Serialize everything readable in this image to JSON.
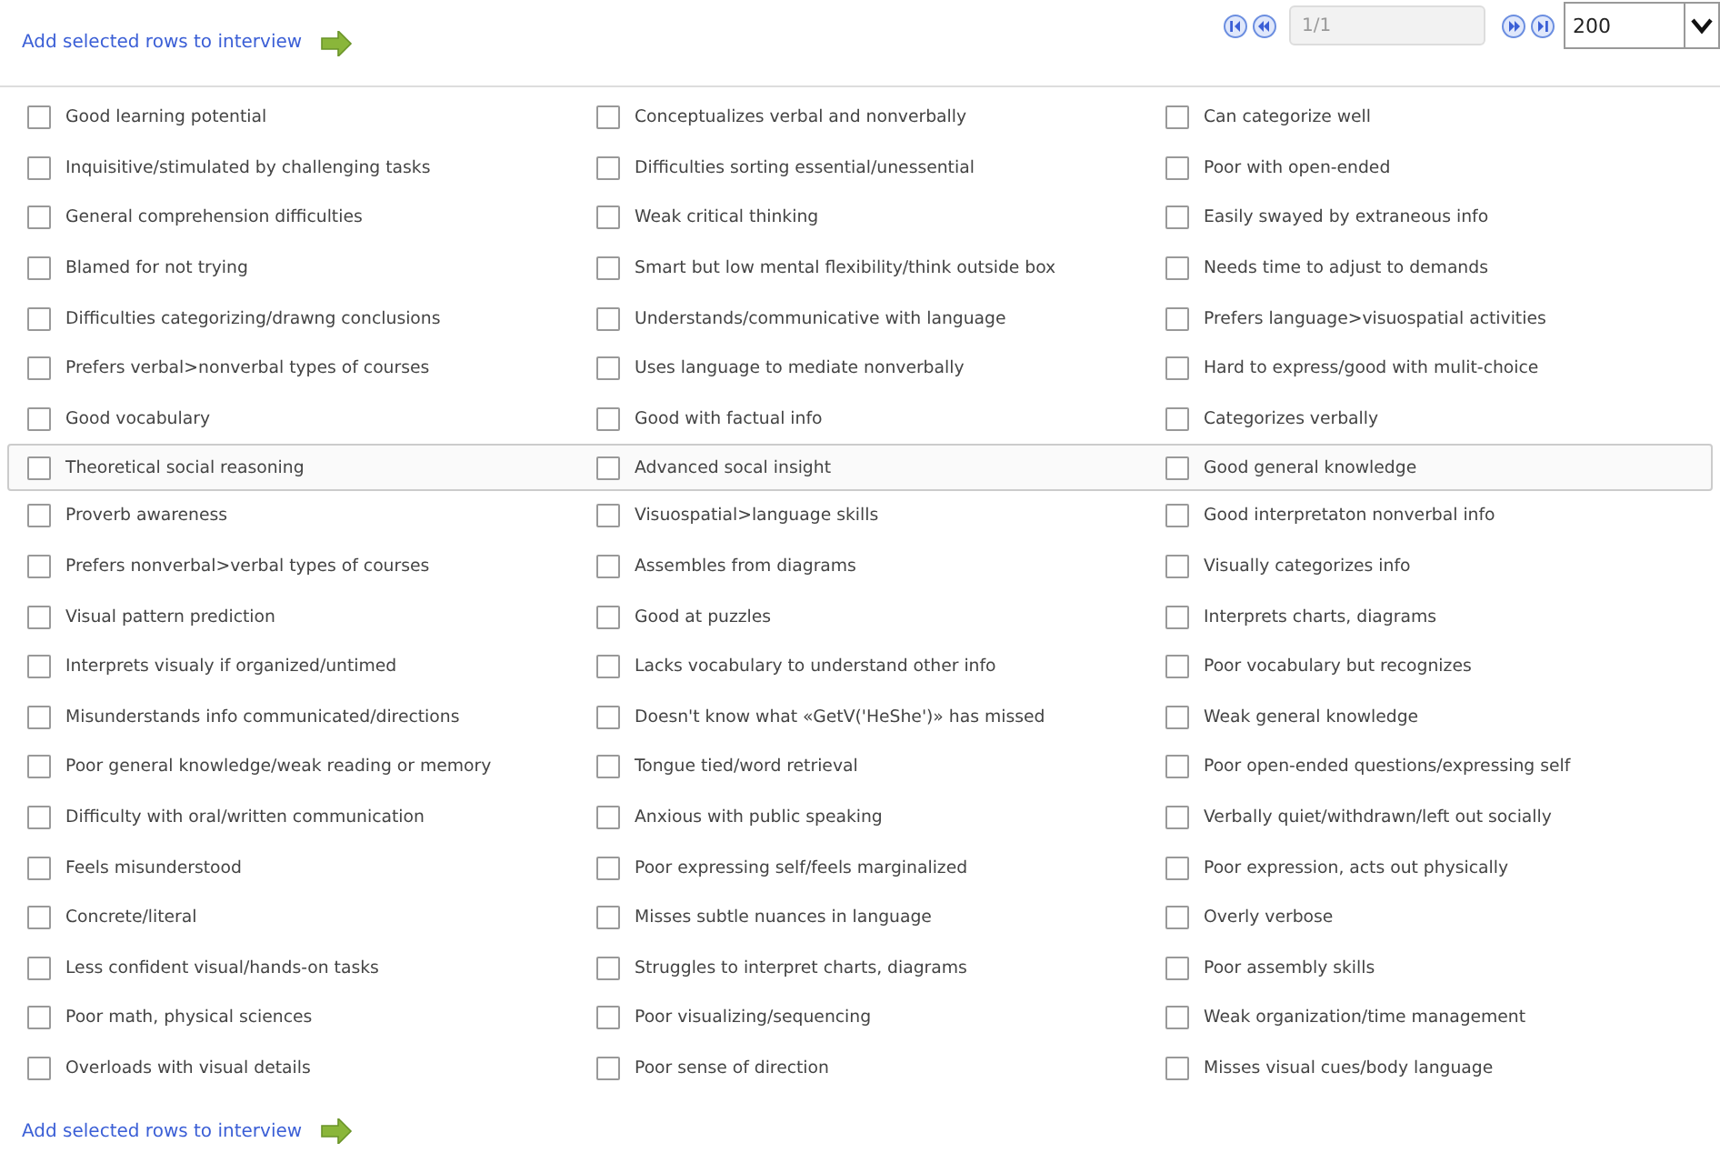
{
  "top_link": {
    "label": "Add selected rows to interview"
  },
  "pager": {
    "page": "1/1",
    "page_size": "200"
  },
  "rows": [
    {
      "highlighted": false,
      "items": [
        {
          "label": "Good learning potential",
          "checked": false
        },
        {
          "label": "Conceptualizes verbal and nonverbally",
          "checked": false
        },
        {
          "label": "Can categorize well",
          "checked": false
        }
      ]
    },
    {
      "highlighted": false,
      "items": [
        {
          "label": "Inquisitive/stimulated by challenging tasks",
          "checked": false
        },
        {
          "label": "Difficulties sorting essential/unessential",
          "checked": false
        },
        {
          "label": "Poor with open-ended",
          "checked": false
        }
      ]
    },
    {
      "highlighted": false,
      "items": [
        {
          "label": "General comprehension difficulties",
          "checked": false
        },
        {
          "label": "Weak critical thinking",
          "checked": false
        },
        {
          "label": "Easily swayed by extraneous info",
          "checked": false
        }
      ]
    },
    {
      "highlighted": false,
      "items": [
        {
          "label": "Blamed for not trying",
          "checked": false
        },
        {
          "label": "Smart but low mental flexibility/think outside box",
          "checked": false
        },
        {
          "label": "Needs time to adjust to demands",
          "checked": false
        }
      ]
    },
    {
      "highlighted": false,
      "items": [
        {
          "label": "Difficulties categorizing/drawng conclusions",
          "checked": false
        },
        {
          "label": "Understands/communicative with language",
          "checked": false
        },
        {
          "label": "Prefers language>visuospatial activities",
          "checked": false
        }
      ]
    },
    {
      "highlighted": false,
      "items": [
        {
          "label": "Prefers verbal>nonverbal types of courses",
          "checked": false
        },
        {
          "label": "Uses language to mediate nonverbally",
          "checked": false
        },
        {
          "label": "Hard to express/good with mulit-choice",
          "checked": false
        }
      ]
    },
    {
      "highlighted": false,
      "items": [
        {
          "label": "Good vocabulary",
          "checked": false
        },
        {
          "label": "Good with factual info",
          "checked": false
        },
        {
          "label": "Categorizes verbally",
          "checked": false
        }
      ]
    },
    {
      "highlighted": true,
      "items": [
        {
          "label": "Theoretical social reasoning",
          "checked": false
        },
        {
          "label": "Advanced socal insight",
          "checked": false
        },
        {
          "label": "Good general knowledge",
          "checked": false
        }
      ]
    },
    {
      "highlighted": false,
      "items": [
        {
          "label": "Proverb awareness",
          "checked": false
        },
        {
          "label": "Visuospatial>language skills",
          "checked": false
        },
        {
          "label": "Good interpretaton nonverbal info",
          "checked": false
        }
      ]
    },
    {
      "highlighted": false,
      "items": [
        {
          "label": "Prefers nonverbal>verbal types of courses",
          "checked": false
        },
        {
          "label": "Assembles from diagrams",
          "checked": false
        },
        {
          "label": "Visually categorizes info",
          "checked": false
        }
      ]
    },
    {
      "highlighted": false,
      "items": [
        {
          "label": "Visual pattern prediction",
          "checked": false
        },
        {
          "label": "Good at puzzles",
          "checked": false
        },
        {
          "label": "Interprets charts, diagrams",
          "checked": false
        }
      ]
    },
    {
      "highlighted": false,
      "items": [
        {
          "label": "Interprets visualy if organized/untimed",
          "checked": false
        },
        {
          "label": "Lacks vocabulary to understand other info",
          "checked": false
        },
        {
          "label": "Poor vocabulary but recognizes",
          "checked": false
        }
      ]
    },
    {
      "highlighted": false,
      "items": [
        {
          "label": "Misunderstands info communicated/directions",
          "checked": false
        },
        {
          "label": "Doesn't know what «GetV('HeShe')» has missed",
          "checked": false
        },
        {
          "label": "Weak general knowledge",
          "checked": false
        }
      ]
    },
    {
      "highlighted": false,
      "items": [
        {
          "label": "Poor general knowledge/weak reading or memory",
          "checked": false
        },
        {
          "label": "Tongue tied/word retrieval",
          "checked": false
        },
        {
          "label": "Poor open-ended questions/expressing self",
          "checked": false
        }
      ]
    },
    {
      "highlighted": false,
      "items": [
        {
          "label": "Difficulty with oral/written communication",
          "checked": false
        },
        {
          "label": "Anxious with public speaking",
          "checked": false
        },
        {
          "label": "Verbally quiet/withdrawn/left out socially",
          "checked": false
        }
      ]
    },
    {
      "highlighted": false,
      "items": [
        {
          "label": "Feels misunderstood",
          "checked": false
        },
        {
          "label": "Poor expressing self/feels marginalized",
          "checked": false
        },
        {
          "label": "Poor expression, acts out physically",
          "checked": false
        }
      ]
    },
    {
      "highlighted": false,
      "items": [
        {
          "label": "Concrete/literal",
          "checked": false
        },
        {
          "label": "Misses subtle nuances in language",
          "checked": false
        },
        {
          "label": "Overly verbose",
          "checked": false
        }
      ]
    },
    {
      "highlighted": false,
      "items": [
        {
          "label": "Less confident visual/hands-on tasks",
          "checked": false
        },
        {
          "label": "Struggles to interpret charts, diagrams",
          "checked": false
        },
        {
          "label": "Poor assembly skills",
          "checked": false
        }
      ]
    },
    {
      "highlighted": false,
      "items": [
        {
          "label": "Poor math, physical sciences",
          "checked": false
        },
        {
          "label": "Poor visualizing/sequencing",
          "checked": false
        },
        {
          "label": "Weak organization/time management",
          "checked": false
        }
      ]
    },
    {
      "highlighted": false,
      "items": [
        {
          "label": "Overloads with visual details",
          "checked": false
        },
        {
          "label": "Poor sense of direction",
          "checked": false
        },
        {
          "label": "Misses visual cues/body language",
          "checked": false
        }
      ]
    }
  ],
  "bottom_link": {
    "label": "Add selected rows to interview"
  }
}
